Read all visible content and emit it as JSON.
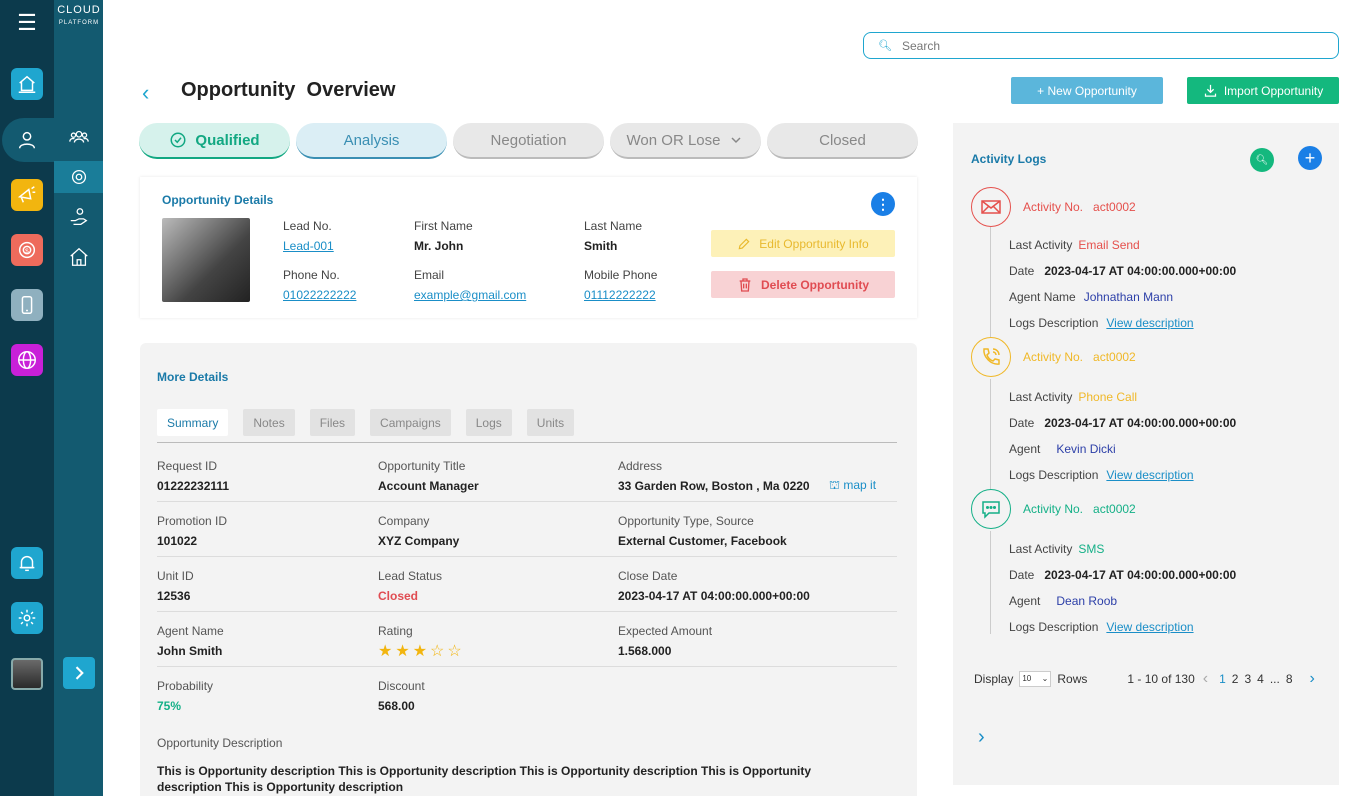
{
  "app": {
    "logo_top": "CLOUD",
    "logo_bottom": "PLATFORM"
  },
  "search": {
    "placeholder": "Search"
  },
  "page": {
    "title": "Opportunity  Overview",
    "new_btn": "+ New Opportunity",
    "import_btn": "Import Opportunity"
  },
  "stages": [
    {
      "label": "Qualified",
      "state": "done"
    },
    {
      "label": "Analysis",
      "state": "active"
    },
    {
      "label": "Negotiation",
      "state": "pending"
    },
    {
      "label": "Won OR Lose",
      "state": "pending"
    },
    {
      "label": "Closed",
      "state": "pending"
    }
  ],
  "details": {
    "section": "Opportunity Details",
    "lead_no_k": "Lead No.",
    "lead_no_v": "Lead-001",
    "first_k": "First Name",
    "first_v": "Mr. John",
    "last_k": "Last Name",
    "last_v": "Smith",
    "phone_k": "Phone No.",
    "phone_v": "01022222222",
    "email_k": "Email",
    "email_v": "example@gmail.com",
    "mobile_k": "Mobile Phone",
    "mobile_v": "01112222222",
    "edit_btn": "Edit Opportunity Info",
    "delete_btn": "Delete Opportunity"
  },
  "more": {
    "section": "More Details",
    "tabs": [
      "Summary",
      "Notes",
      "Files",
      "Campaigns",
      "Logs",
      "Units"
    ],
    "rows": [
      [
        {
          "k": "Request ID",
          "v": "01222232111"
        },
        {
          "k": "Opportunity Title",
          "v": "Account Manager"
        },
        {
          "k": "Address",
          "v": "33 Garden Row, Boston , Ma 0220"
        }
      ],
      [
        {
          "k": "Promotion ID",
          "v": "101022"
        },
        {
          "k": "Company",
          "v": "XYZ Company"
        },
        {
          "k": "Opportunity Type, Source",
          "v": "External Customer, Facebook"
        }
      ],
      [
        {
          "k": "Unit ID",
          "v": "12536"
        },
        {
          "k": "Lead Status",
          "v": "Closed"
        },
        {
          "k": "Close Date",
          "v": "2023-04-17 AT 04:00:00.000+00:00"
        }
      ],
      [
        {
          "k": "Agent Name",
          "v": "John Smith"
        },
        {
          "k": "Rating",
          "v": ""
        },
        {
          "k": "Expected Amount",
          "v": "1.568.000"
        }
      ],
      [
        {
          "k": "Probability",
          "v": "75%"
        },
        {
          "k": "Discount",
          "v": "568.00"
        }
      ]
    ],
    "map_it": "map it",
    "rating": 3,
    "rating_max": 5,
    "desc_k": "Opportunity Description",
    "desc_v": "This is Opportunity description This is Opportunity description This is Opportunity description This is Opportunity description This is Opportunity description"
  },
  "activity": {
    "title": "Activity Logs",
    "items": [
      {
        "icon": "mail-icon",
        "color": "#e5504c",
        "no_k": "Activity No.",
        "no_v": "act0002",
        "last_k": "Last Activity",
        "last_v": "Email Send",
        "date_k": "Date",
        "date_v": "2023-04-17 AT 04:00:00.000+00:00",
        "agent_k": "Agent Name",
        "agent_v": "Johnathan Mann",
        "desc_k": "Logs Description",
        "desc_v": "View description"
      },
      {
        "icon": "phone-icon",
        "color": "#f0b828",
        "no_k": "Activity No.",
        "no_v": "act0002",
        "last_k": "Last Activity",
        "last_v": "Phone Call",
        "date_k": "Date",
        "date_v": "2023-04-17 AT 04:00:00.000+00:00",
        "agent_k": "Agent",
        "agent_v": "Kevin Dicki",
        "desc_k": "Logs Description",
        "desc_v": "View description"
      },
      {
        "icon": "chat-icon",
        "color": "#14b087",
        "no_k": "Activity No.",
        "no_v": "act0002",
        "last_k": "Last Activity",
        "last_v": "SMS",
        "date_k": "Date",
        "date_v": "2023-04-17 AT 04:00:00.000+00:00",
        "agent_k": "Agent",
        "agent_v": "Dean Roob",
        "desc_k": "Logs Description",
        "desc_v": "View description"
      }
    ],
    "pager": {
      "display": "Display",
      "rows_select": "10",
      "rows": "Rows",
      "range": "1 - 10 of 130",
      "pages": [
        "1",
        "2",
        "3",
        "4",
        "...",
        "8"
      ],
      "current": "1"
    }
  }
}
